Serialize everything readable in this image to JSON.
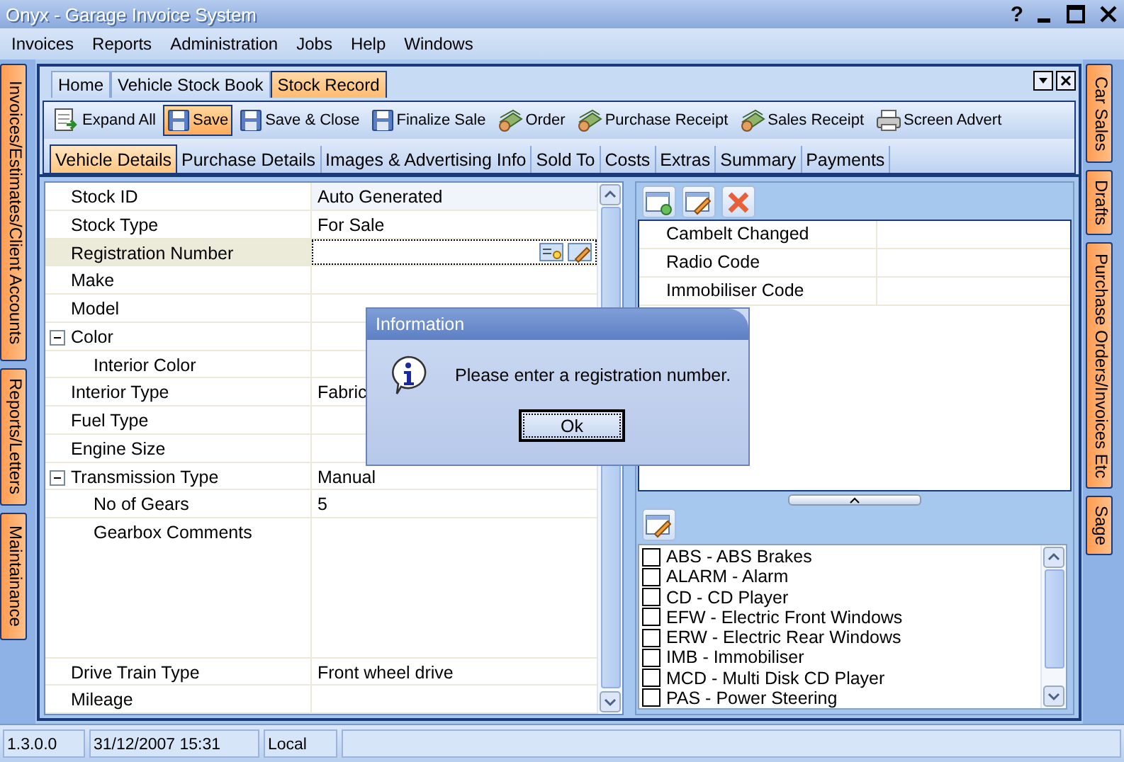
{
  "window": {
    "title": "Onyx - Garage Invoice System",
    "help": "?"
  },
  "menu": [
    "Invoices",
    "Reports",
    "Administration",
    "Jobs",
    "Help",
    "Windows"
  ],
  "left_tabs": [
    "Invoices/Estimates/Client Accounts",
    "Reports/Letters",
    "Maintainance"
  ],
  "right_tabs": [
    "Car Sales",
    "Drafts",
    "Purchase Orders/Invoices Etc",
    "Sage"
  ],
  "doc_tabs": [
    {
      "label": "Home",
      "selected": false
    },
    {
      "label": "Vehicle Stock Book",
      "selected": false
    },
    {
      "label": "Stock Record",
      "selected": true
    }
  ],
  "toolbar": [
    {
      "label": "Expand All",
      "kind": "expand",
      "active": false
    },
    {
      "label": "Save",
      "kind": "save",
      "active": true
    },
    {
      "label": "Save & Close",
      "kind": "save",
      "active": false
    },
    {
      "label": "Finalize Sale",
      "kind": "save",
      "active": false
    },
    {
      "label": "Order",
      "kind": "money",
      "active": false
    },
    {
      "label": "Purchase Receipt",
      "kind": "money",
      "active": false
    },
    {
      "label": "Sales Receipt",
      "kind": "money",
      "active": false
    },
    {
      "label": "Screen Advert",
      "kind": "print",
      "active": false
    }
  ],
  "sub_tabs": [
    {
      "label": "Vehicle Details",
      "selected": true
    },
    {
      "label": "Purchase Details",
      "selected": false
    },
    {
      "label": "Images & Advertising Info",
      "selected": false
    },
    {
      "label": "Sold To",
      "selected": false
    },
    {
      "label": "Costs",
      "selected": false
    },
    {
      "label": "Extras",
      "selected": false
    },
    {
      "label": "Summary",
      "selected": false
    },
    {
      "label": "Payments",
      "selected": false
    }
  ],
  "properties": [
    {
      "label": "Stock ID",
      "value": "Auto Generated",
      "kind": "readonly",
      "selected": false
    },
    {
      "label": "Stock Type",
      "value": "For Sale",
      "kind": "text",
      "selected": false
    },
    {
      "label": "Registration Number",
      "kind": "lookup",
      "selected": true
    },
    {
      "label": "Make",
      "kind": "text",
      "selected": false
    },
    {
      "label": "Model",
      "kind": "text",
      "selected": false
    },
    {
      "label": "Color",
      "kind": "text",
      "selected": false,
      "expanded": true,
      "children": [
        {
          "label": "Interior Color",
          "kind": "text",
          "selected": false
        }
      ]
    },
    {
      "label": "Interior Type",
      "value": "Fabric",
      "kind": "text",
      "selected": false
    },
    {
      "label": "Fuel Type",
      "kind": "text",
      "selected": false
    },
    {
      "label": "Engine Size",
      "kind": "text",
      "selected": false
    },
    {
      "label": "Transmission Type",
      "value": "Manual",
      "kind": "text",
      "selected": false,
      "expanded": true,
      "children": [
        {
          "label": "No of Gears",
          "value": "5",
          "kind": "text",
          "selected": false
        },
        {
          "label": "Gearbox Comments",
          "kind": "memo",
          "selected": false
        }
      ]
    },
    {
      "label": "Drive Train Type",
      "value": "Front wheel drive",
      "kind": "text",
      "selected": false
    },
    {
      "label": "Mileage",
      "kind": "text",
      "selected": false
    }
  ],
  "custom_fields": [
    {
      "label": "Cambelt Changed"
    },
    {
      "label": "Radio Code"
    },
    {
      "label": "Immobiliser Code"
    }
  ],
  "extras": [
    {
      "label": "ABS - ABS Brakes",
      "checked": false
    },
    {
      "label": "ALARM - Alarm",
      "checked": false
    },
    {
      "label": "CD - CD Player",
      "checked": false
    },
    {
      "label": "EFW - Electric Front Windows",
      "checked": false
    },
    {
      "label": "ERW - Electric Rear Windows",
      "checked": false
    },
    {
      "label": "IMB - Immobiliser",
      "checked": false
    },
    {
      "label": "MCD - Multi Disk CD Player",
      "checked": false
    },
    {
      "label": "PAS - Power Steering",
      "checked": false
    }
  ],
  "dialog": {
    "title": "Information",
    "message": "Please enter a registration number.",
    "button": "Ok"
  },
  "status_bar": [
    "1.3.0.0",
    "31/12/2007 15:31",
    "Local"
  ]
}
